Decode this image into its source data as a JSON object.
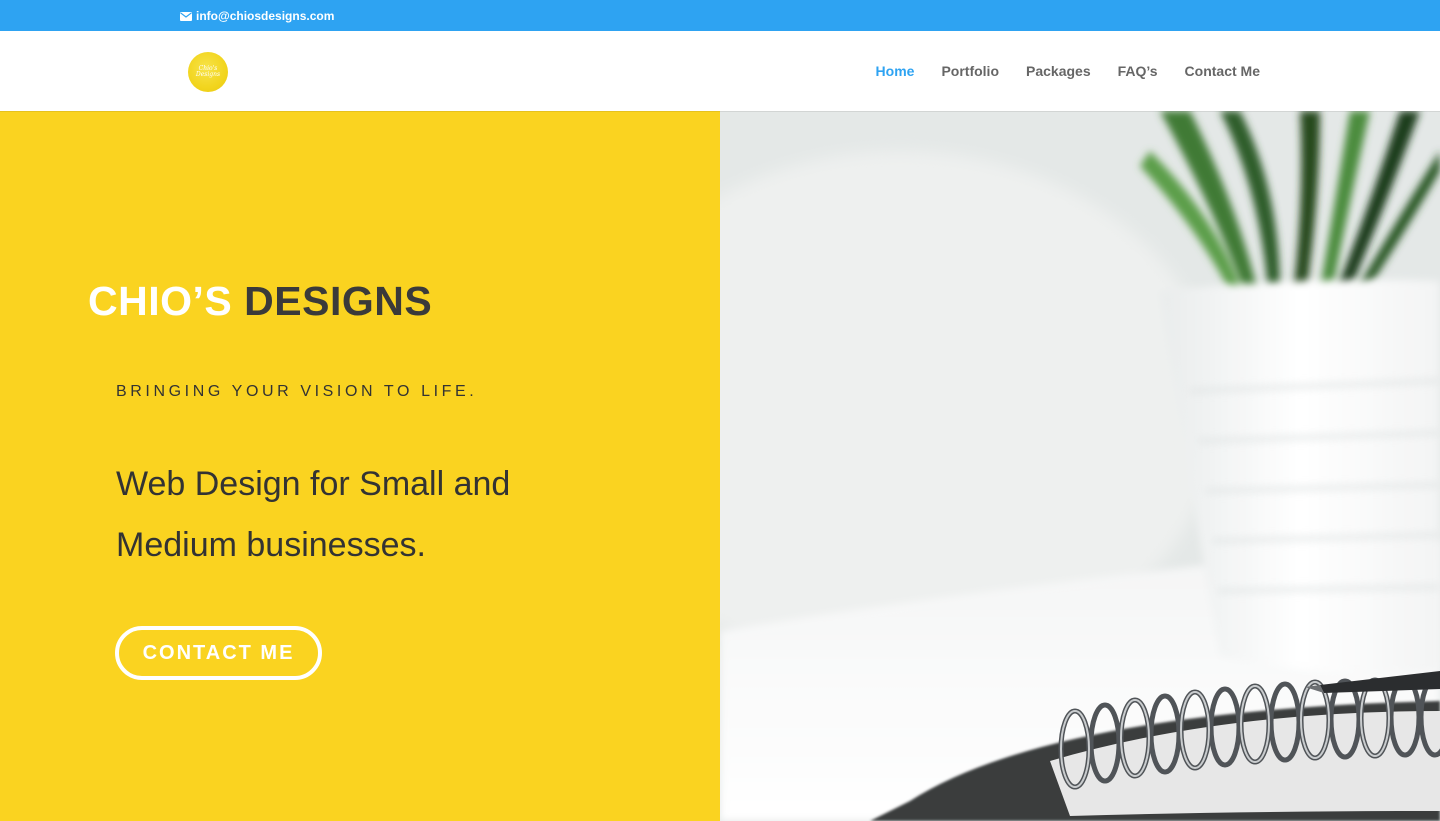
{
  "topbar": {
    "email": "info@chiosdesigns.com",
    "icon": "envelope-icon",
    "color": "#2ea3f2"
  },
  "header": {
    "logo_text": "Chio's Designs",
    "nav": [
      {
        "label": "Home",
        "active": true
      },
      {
        "label": "Portfolio",
        "active": false
      },
      {
        "label": "Packages",
        "active": false
      },
      {
        "label": "FAQ’s",
        "active": false
      },
      {
        "label": "Contact Me",
        "active": false
      }
    ],
    "active_color": "#2ea3f2"
  },
  "hero": {
    "title_first": "CHIO’S",
    "title_second": "DESIGNS",
    "tagline": "BRINGING YOUR VISION TO LIFE.",
    "headline": "Web Design for Small and Medium businesses.",
    "cta_label": "CONTACT ME",
    "background_color": "#fad320"
  }
}
